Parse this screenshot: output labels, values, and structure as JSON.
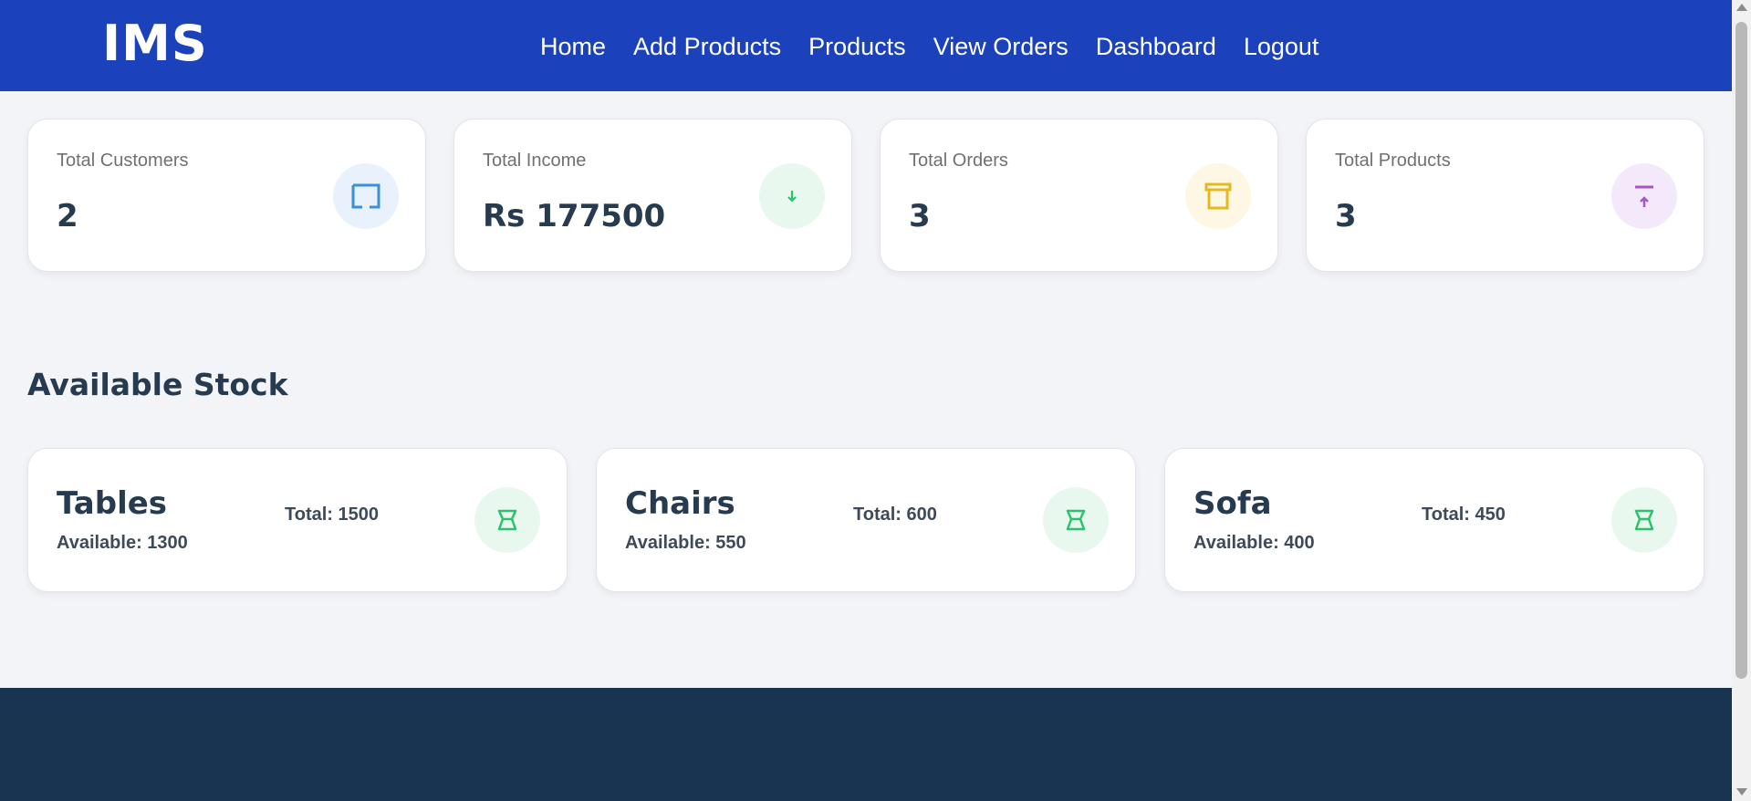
{
  "nav": {
    "logo": "IMS",
    "links": [
      "Home",
      "Add Products",
      "Products",
      "View Orders",
      "Dashboard",
      "Logout"
    ]
  },
  "stats": [
    {
      "label": "Total Customers",
      "value": "2",
      "icon": "square-outline-icon",
      "color": "#3a8fd8",
      "bg": "#e8f1fc"
    },
    {
      "label": "Total Income",
      "value": "Rs 177500",
      "icon": "arrow-down-icon",
      "color": "#2bc26b",
      "bg": "#e9f8ef"
    },
    {
      "label": "Total Orders",
      "value": "3",
      "icon": "archive-box-icon",
      "color": "#e6b820",
      "bg": "#fdf7e3"
    },
    {
      "label": "Total Products",
      "value": "3",
      "icon": "upload-icon",
      "color": "#a256c8",
      "bg": "#f4e9fb"
    }
  ],
  "stock": {
    "title": "Available Stock",
    "items": [
      {
        "name": "Tables",
        "available": "Available: 1300",
        "total": "Total: 1500"
      },
      {
        "name": "Chairs",
        "available": "Available: 550",
        "total": "Total: 600"
      },
      {
        "name": "Sofa",
        "available": "Available: 400",
        "total": "Total: 450"
      }
    ],
    "icon": "basket-icon",
    "icon_color": "#2bc26b"
  }
}
